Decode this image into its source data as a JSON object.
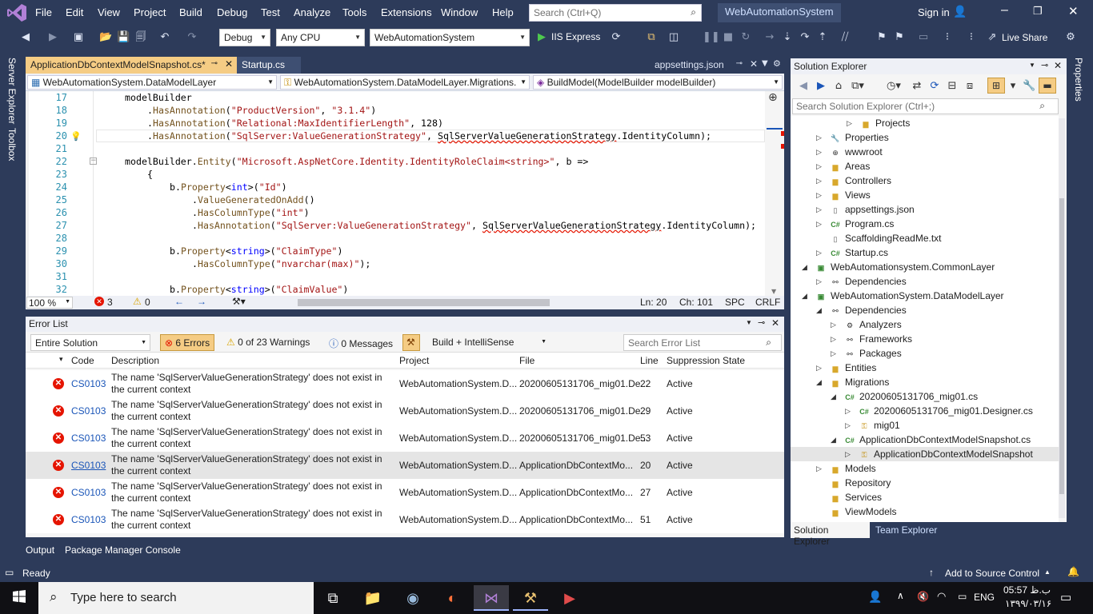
{
  "menu": {
    "items": [
      "File",
      "Edit",
      "View",
      "Project",
      "Build",
      "Debug",
      "Test",
      "Analyze",
      "Tools",
      "Extensions",
      "Window",
      "Help"
    ],
    "search_placeholder": "Search (Ctrl+Q)",
    "solution_name": "WebAutomationSystem",
    "sign_in": "Sign in"
  },
  "toolbar": {
    "config": "Debug",
    "platform": "Any CPU",
    "startup_project": "WebAutomationSystem",
    "run_target": "IIS Express",
    "live_share": "Live Share"
  },
  "side_tabs": {
    "server_explorer": "Server Explorer",
    "toolbox": "Toolbox",
    "properties": "Properties"
  },
  "editor": {
    "tabs": [
      {
        "label": "ApplicationDbContextModelSnapshot.cs*",
        "active": true
      },
      {
        "label": "Startup.cs",
        "active": false
      },
      {
        "label": "appsettings.json",
        "active": false
      }
    ],
    "nav": {
      "project": "WebAutomationSystem.DataModelLayer",
      "type": "WebAutomationSystem.DataModelLayer.Migrations.",
      "member": "BuildModel(ModelBuilder modelBuilder)"
    },
    "line_numbers": [
      "17",
      "18",
      "19",
      "20",
      "21",
      "22",
      "23",
      "24",
      "25",
      "26",
      "27",
      "28",
      "29",
      "30",
      "31",
      "32"
    ],
    "status": {
      "zoom": "100 %",
      "errors": "3",
      "warnings": "0",
      "ln": "Ln: 20",
      "ch": "Ch: 101",
      "spc": "SPC",
      "eol": "CRLF"
    }
  },
  "error_list": {
    "title": "Error List",
    "scope": "Entire Solution",
    "errors_btn": "6 Errors",
    "warnings_btn": "0 of 23 Warnings",
    "messages_btn": "0 Messages",
    "source": "Build + IntelliSense",
    "search_placeholder": "Search Error List",
    "columns": [
      "Code",
      "Description",
      "Project",
      "File",
      "Line",
      "Suppression State"
    ],
    "rows": [
      {
        "code": "CS0103",
        "desc": "The name 'SqlServerValueGenerationStrategy' does not exist in the current context",
        "project": "WebAutomationSystem.D...",
        "file": "20200605131706_mig01.De...",
        "line": "22",
        "state": "Active"
      },
      {
        "code": "CS0103",
        "desc": "The name 'SqlServerValueGenerationStrategy' does not exist in the current context",
        "project": "WebAutomationSystem.D...",
        "file": "20200605131706_mig01.De...",
        "line": "29",
        "state": "Active"
      },
      {
        "code": "CS0103",
        "desc": "The name 'SqlServerValueGenerationStrategy' does not exist in the current context",
        "project": "WebAutomationSystem.D...",
        "file": "20200605131706_mig01.De...",
        "line": "53",
        "state": "Active"
      },
      {
        "code": "CS0103",
        "desc": "The name 'SqlServerValueGenerationStrategy' does not exist in the current context",
        "project": "WebAutomationSystem.D...",
        "file": "ApplicationDbContextMo...",
        "line": "20",
        "state": "Active"
      },
      {
        "code": "CS0103",
        "desc": "The name 'SqlServerValueGenerationStrategy' does not exist in the current context",
        "project": "WebAutomationSystem.D...",
        "file": "ApplicationDbContextMo...",
        "line": "27",
        "state": "Active"
      },
      {
        "code": "CS0103",
        "desc": "The name 'SqlServerValueGenerationStrategy' does not exist in the current context",
        "project": "WebAutomationSystem.D...",
        "file": "ApplicationDbContextMo...",
        "line": "51",
        "state": "Active"
      }
    ]
  },
  "bottom_tabs": [
    "Output",
    "Package Manager Console"
  ],
  "solution_explorer": {
    "title": "Solution Explorer",
    "search_placeholder": "Search Solution Explorer (Ctrl+;)",
    "nodes": [
      {
        "label": "Projects",
        "icon": "folder"
      },
      {
        "label": "Properties",
        "icon": "properties"
      },
      {
        "label": "wwwroot",
        "icon": "globe"
      },
      {
        "label": "Areas",
        "icon": "folder"
      },
      {
        "label": "Controllers",
        "icon": "folder"
      },
      {
        "label": "Views",
        "icon": "folder"
      },
      {
        "label": "appsettings.json",
        "icon": "file"
      },
      {
        "label": "Program.cs",
        "icon": "cs"
      },
      {
        "label": "ScaffoldingReadMe.txt",
        "icon": "file"
      },
      {
        "label": "Startup.cs",
        "icon": "cs"
      },
      {
        "label": "WebAutomationsystem.CommonLayer",
        "icon": "project"
      },
      {
        "label": "Dependencies",
        "icon": "dependencies"
      },
      {
        "label": "WebAutomationSystem.DataModelLayer",
        "icon": "project"
      },
      {
        "label": "Dependencies",
        "icon": "dependencies"
      },
      {
        "label": "Analyzers",
        "icon": "analyzer"
      },
      {
        "label": "Frameworks",
        "icon": "framework"
      },
      {
        "label": "Packages",
        "icon": "package"
      },
      {
        "label": "Entities",
        "icon": "folder"
      },
      {
        "label": "Migrations",
        "icon": "folder"
      },
      {
        "label": "20200605131706_mig01.cs",
        "icon": "cs"
      },
      {
        "label": "20200605131706_mig01.Designer.cs",
        "icon": "cs"
      },
      {
        "label": "mig01",
        "icon": "class"
      },
      {
        "label": "ApplicationDbContextModelSnapshot.cs",
        "icon": "cs"
      },
      {
        "label": "ApplicationDbContextModelSnapshot",
        "icon": "class"
      },
      {
        "label": "Models",
        "icon": "folder"
      },
      {
        "label": "Repository",
        "icon": "folder"
      },
      {
        "label": "Services",
        "icon": "folder"
      },
      {
        "label": "ViewModels",
        "icon": "folder"
      }
    ],
    "bottom_tabs": [
      "Solution Explorer",
      "Team Explorer"
    ]
  },
  "statusbar": {
    "state": "Ready",
    "source_control": "Add to Source Control"
  },
  "taskbar": {
    "search_placeholder": "Type here to search",
    "lang": "ENG",
    "time": "05:57 ب.ظ",
    "date": "۱۳۹۹/۰۳/۱۶"
  },
  "colors": {
    "accent": "#2d3b5a",
    "active_tab": "#f5cc84",
    "error": "#e51400",
    "selection": "#e5e5e5"
  }
}
